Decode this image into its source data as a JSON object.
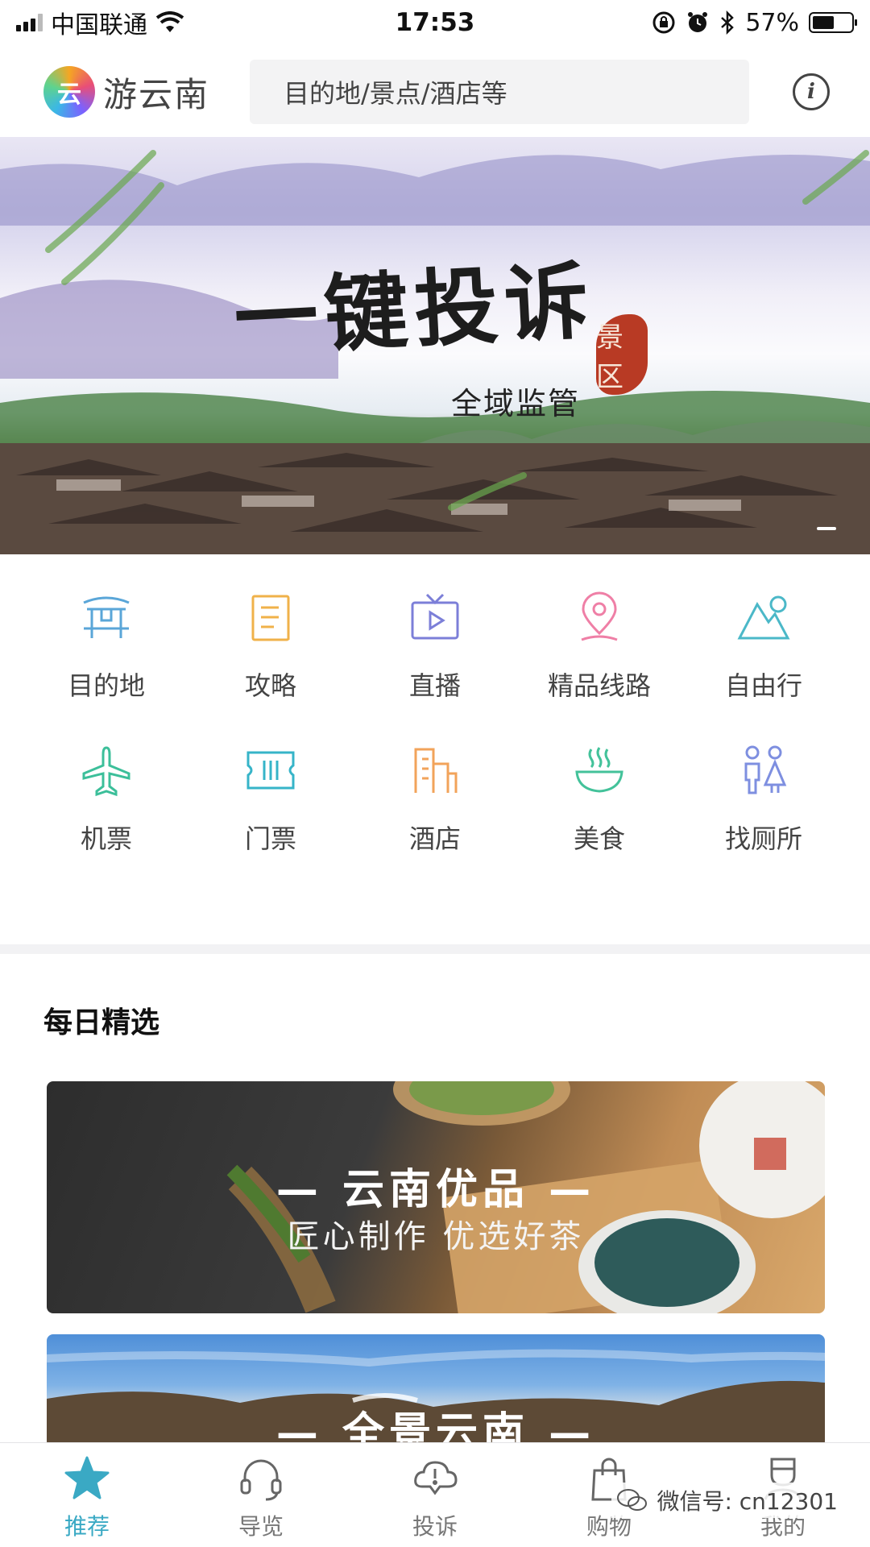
{
  "status_bar": {
    "carrier": "中国联通",
    "time": "17:53",
    "battery": "57%",
    "battery_level": 0.57
  },
  "header": {
    "app_name": "游云南",
    "logo_glyph": "云",
    "search_placeholder": "目的地/景点/酒店等",
    "info_label": "i"
  },
  "banner": {
    "title": "一键投诉",
    "subtitle": "全域监管",
    "seal_text": "景区"
  },
  "quick_menu": [
    {
      "label": "目的地",
      "icon": "gate-icon",
      "color": "#5aa6d8"
    },
    {
      "label": "攻略",
      "icon": "guide-book-icon",
      "color": "#f0b24a"
    },
    {
      "label": "直播",
      "icon": "live-tv-icon",
      "color": "#7c7fd8"
    },
    {
      "label": "精品线路",
      "icon": "location-pin-icon",
      "color": "#ef7fa6"
    },
    {
      "label": "自由行",
      "icon": "mountain-icon",
      "color": "#4bb8c8"
    },
    {
      "label": "机票",
      "icon": "airplane-icon",
      "color": "#3cbf9a"
    },
    {
      "label": "门票",
      "icon": "ticket-icon",
      "color": "#36b4c8"
    },
    {
      "label": "酒店",
      "icon": "hotel-icon",
      "color": "#f2a35a"
    },
    {
      "label": "美食",
      "icon": "food-bowl-icon",
      "color": "#43c29a"
    },
    {
      "label": "找厕所",
      "icon": "restroom-icon",
      "color": "#7e8fe0"
    }
  ],
  "daily": {
    "section_title": "每日精选",
    "cards": [
      {
        "title": "— 云南优品 —",
        "subtitle": "匠心制作 优选好茶"
      },
      {
        "title": "— 全景云南 —"
      }
    ]
  },
  "tab_bar": [
    {
      "label": "推荐",
      "icon": "star-icon",
      "active": true
    },
    {
      "label": "导览",
      "icon": "headset-icon",
      "active": false
    },
    {
      "label": "投诉",
      "icon": "complaint-icon",
      "active": false
    },
    {
      "label": "购物",
      "icon": "shopping-bag-icon",
      "active": false
    },
    {
      "label": "我的",
      "icon": "profile-icon",
      "active": false
    }
  ],
  "watermark": "微信号: cn12301",
  "colors": {
    "accent": "#3aa9c4",
    "tab_inactive": "#777777"
  }
}
